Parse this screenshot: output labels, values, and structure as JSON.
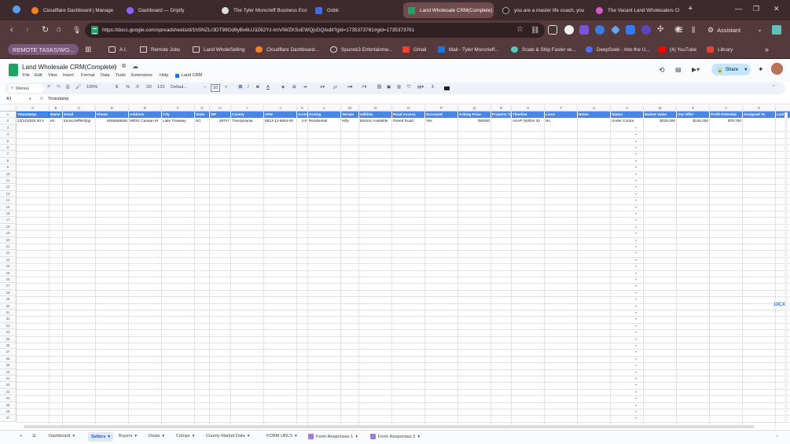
{
  "browser": {
    "tabs": [
      {
        "label": "",
        "fav": "#5b9cf0"
      },
      {
        "label": "Cloudflare Dashboard | Manage",
        "fav": "#f48120"
      },
      {
        "label": "Dashboard — Dripify",
        "fav": "#8a63f5"
      },
      {
        "label": "The Tyler Moncrieff Business Eco",
        "fav": "#dddddd"
      },
      {
        "label": "Gobii",
        "fav": "#3b6ef0"
      },
      {
        "label": "Land Wholesale CRM(Complete)",
        "fav": "#1ea362"
      },
      {
        "label": "you are a master life coach, you",
        "fav": "#222222"
      },
      {
        "label": "The Vacant Land Wholesalers Cl",
        "fav": "#d35bc8"
      }
    ],
    "new_tab": "+",
    "url": "https://docs.google.com/spreadsheets/d/1hSNZLr3DT99Od9yBv6UJ3Z62Yz-tmVIWZKSoEWQjcDQ/edit?gid=1735373761#gid=1735373761",
    "assistant": "Assistant",
    "bookmarks": [
      "REMOTE TASKS/WO...",
      "A.I.",
      "Remote Jobs",
      "Land WholeSelling",
      "Cloudflare Dashboard...",
      "Spunnk3 Entertainme...",
      "Gmail",
      "Mail - Tyler Moncrieff...",
      "Scale & Ship Faster wi...",
      "DeepSeek - Into the U...",
      "(4) YouTube",
      "Library"
    ]
  },
  "sheet": {
    "doc_title": "Land Wholesale CRM(Complete)",
    "menus": [
      "File",
      "Edit",
      "View",
      "Insert",
      "Format",
      "Data",
      "Tools",
      "Extensions",
      "Help"
    ],
    "land_crm": "Land CRM",
    "share": "Share",
    "toolbar": {
      "search": "Menus",
      "zoom": "100%",
      "currency": "$",
      "percent": "%",
      "dec1": ".0",
      "dec2": ".00",
      "fmt": "123",
      "font": "Defaul...",
      "size": "10"
    },
    "cell_ref": "A1",
    "fx": "fx",
    "formula": "Timestamp",
    "columns": [
      "A",
      "B",
      "C",
      "D",
      "E",
      "F",
      "G",
      "H",
      "I",
      "J",
      "K",
      "L",
      "M",
      "N",
      "O",
      "P",
      "Q",
      "R",
      "S",
      "T",
      "U",
      "V",
      "W",
      "X",
      "Y",
      "Z",
      ""
    ],
    "headers": [
      "Timestamp",
      "Name",
      "Email",
      "Phone",
      "Address",
      "City",
      "State",
      "ZIP",
      "County",
      "APN",
      "Acres",
      "Zoning",
      "Terrain",
      "Utilities",
      "Road Access",
      "Surveyed",
      "Asking Price",
      "Property Ty",
      "Timeline",
      "Liens",
      "Notes",
      "Status",
      "Market Value",
      "Our Offer",
      "Profit Potential",
      "Assigned To",
      "Last C"
    ],
    "row2": [
      "12/12/2025 20:4",
      "tet",
      "tmoncrieff94@gr",
      "5555555555",
      "MRS1 Canaan M",
      "Lake Toxaway",
      "NC",
      "28747",
      "Transylvania",
      "8513-12-5664-00",
      "4.5",
      "Residential",
      "Hilly",
      "Electric Available",
      "Paved Road",
      "Yes",
      "350000",
      "",
      "ASAP (Within 30",
      "No",
      "",
      "Under Contra",
      "$225,000",
      "$146,250",
      "$78,750",
      "",
      ""
    ],
    "row_count": 47,
    "sheet_tabs": [
      "Dashboard",
      "Sellers",
      "Buyers",
      "Deals",
      "Comps",
      "County Market Data",
      "FORM URLS",
      "Form Responses 1",
      "Form Responses 2"
    ],
    "active_tab": "Sellers",
    "side_badge": "10CX"
  }
}
